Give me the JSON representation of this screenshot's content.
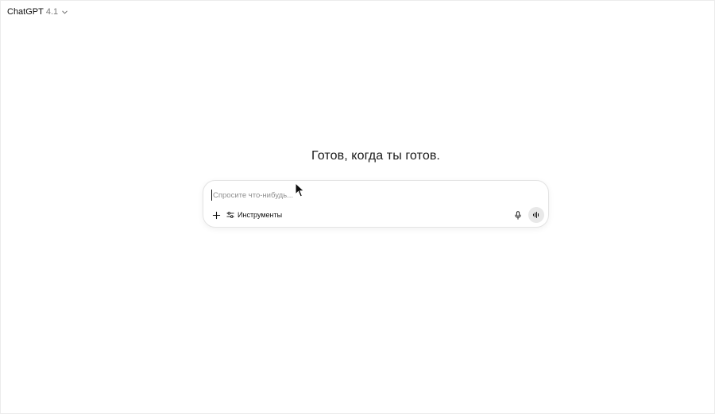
{
  "header": {
    "model_name": "ChatGPT",
    "model_version": "4.1",
    "chevron_icon": "chevron-down-icon"
  },
  "main": {
    "headline": "Готов, когда ты готов."
  },
  "composer": {
    "placeholder": "Спросите что-нибудь...",
    "value": "",
    "plus_icon": "plus-icon",
    "tools_icon": "sliders-icon",
    "tools_label": "Инструменты",
    "mic_icon": "microphone-icon",
    "voice_icon": "voice-wave-icon"
  },
  "colors": {
    "background": "#ffffff",
    "text": "#0d0d0d",
    "muted": "#7a7a7a",
    "voice_button_bg": "#e8e8e8"
  }
}
